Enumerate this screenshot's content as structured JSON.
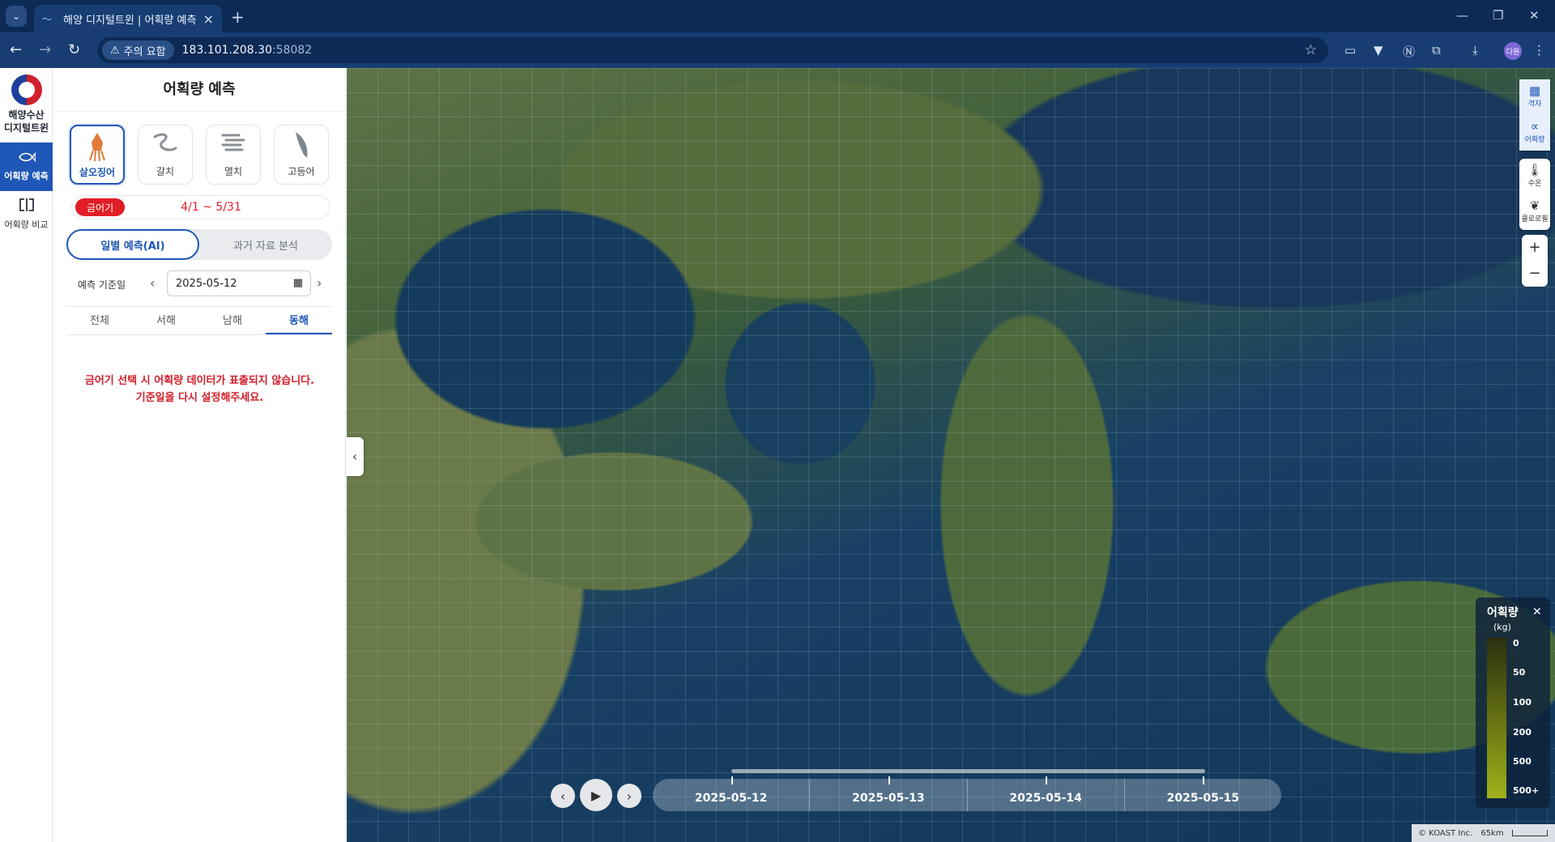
{
  "browser": {
    "tab_title": "해양 디지털트윈 | 어획량 예측",
    "warning": "주의 요함",
    "url_host": "183.101.208.30",
    "url_port": ":58082",
    "avatar": "다원"
  },
  "logo": {
    "line1": "해양수산",
    "line2": "디지털트윈"
  },
  "nav": [
    {
      "label": "어획량 예측",
      "icon": "fish-icon"
    },
    {
      "label": "어획량 비교",
      "icon": "compare-icon"
    }
  ],
  "panel": {
    "title": "어획량 예측",
    "fishes": [
      {
        "label": "살오징어",
        "icon": "squid-icon"
      },
      {
        "label": "갈치",
        "icon": "hairtail-icon"
      },
      {
        "label": "멸치",
        "icon": "anchovy-icon"
      },
      {
        "label": "고등어",
        "icon": "mackerel-icon"
      }
    ],
    "closed_badge": "금어기",
    "closed_range": "4/1 ~ 5/31",
    "toggle_on": "일별 예측(AI)",
    "toggle_off": "과거 자료 분석",
    "date_label": "예측 기준일",
    "date_value": "2025-05-12",
    "regions": [
      "전체",
      "서해",
      "남해",
      "동해"
    ],
    "message_line1": "금어기 선택 시 어획량 데이터가 표출되지 않습니다.",
    "message_line2": "기준일을 다시 설정해주세요."
  },
  "map_controls": {
    "grid": "격자",
    "catch": "어획량",
    "temp": "수온",
    "chlorophyll": "클로로필"
  },
  "legend": {
    "title": "어획량",
    "unit": "(kg)",
    "values": [
      "0",
      "50",
      "100",
      "200",
      "500",
      "500+"
    ]
  },
  "timeline": {
    "dates": [
      "2025-05-12",
      "2025-05-13",
      "2025-05-14",
      "2025-05-15"
    ]
  },
  "attribution": {
    "text": "© KOAST Inc.",
    "scale": "65km"
  }
}
